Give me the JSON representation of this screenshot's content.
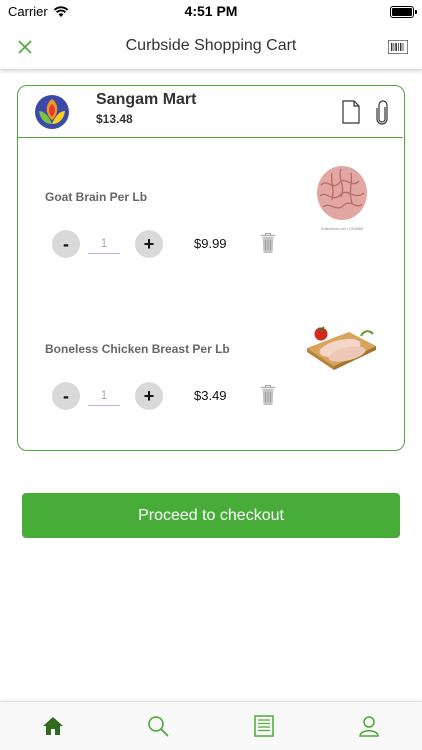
{
  "status_bar": {
    "carrier": "Carrier",
    "time": "4:51 PM"
  },
  "nav": {
    "title": "Curbside Shopping Cart",
    "close_icon": "close-icon",
    "barcode_icon": "barcode-icon"
  },
  "store": {
    "name": "Sangam Mart",
    "total": "$13.48"
  },
  "items": [
    {
      "name": "Goat Brain Per Lb",
      "quantity": "1",
      "price": "$9.99",
      "image_caption": "ShutterStock.com • 10026566"
    },
    {
      "name": "Boneless Chicken Breast Per Lb",
      "quantity": "1",
      "price": "$3.49"
    }
  ],
  "qty_controls": {
    "minus": "-",
    "plus": "+"
  },
  "checkout": {
    "label": "Proceed to checkout"
  },
  "tabs": [
    {
      "name": "home",
      "icon": "home-icon",
      "active": true
    },
    {
      "name": "search",
      "icon": "search-icon",
      "active": false
    },
    {
      "name": "orders",
      "icon": "list-icon",
      "active": false
    },
    {
      "name": "account",
      "icon": "user-icon",
      "active": false
    }
  ],
  "colors": {
    "accent": "#48ac39",
    "active_tab": "#2f6b1f",
    "inactive_tab": "#4ca93a"
  }
}
